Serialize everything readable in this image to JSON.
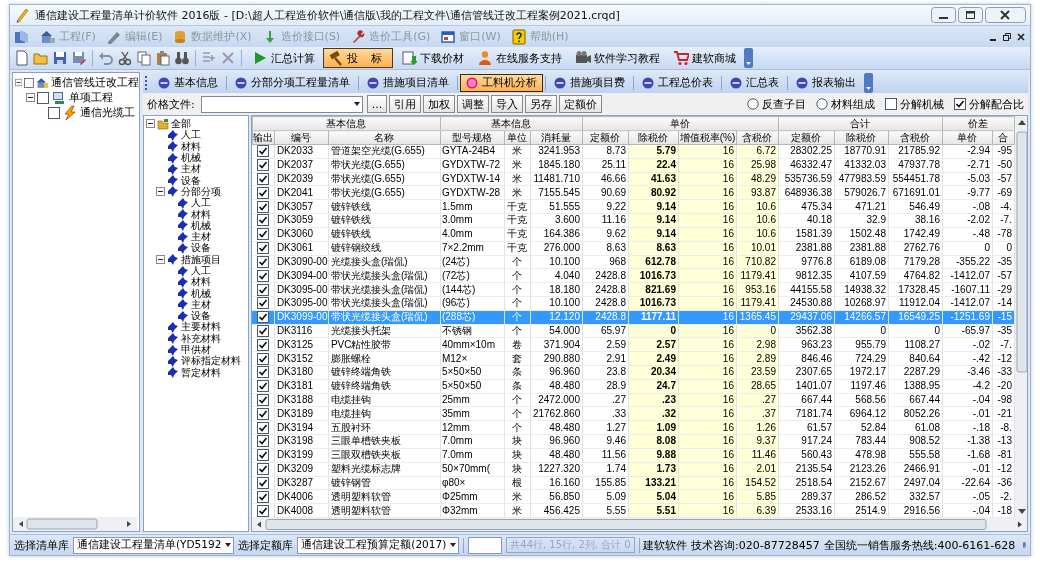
{
  "window": {
    "title": "通信建设工程量清单计价软件 2016版 - [D:\\超人工程造价软件\\通信版\\我的工程文件\\通信管线迁改工程案例2021.crqd]"
  },
  "menu": [
    {
      "label": "工程(F)",
      "disabled": true
    },
    {
      "label": "编辑(E)",
      "disabled": true
    },
    {
      "label": "数据维护(X)",
      "disabled": true
    },
    {
      "label": "造价接口(S)",
      "disabled": true
    },
    {
      "label": "造价工具(G)",
      "disabled": true
    },
    {
      "label": "窗口(W)",
      "disabled": true
    },
    {
      "label": "帮助(H)",
      "disabled": true
    }
  ],
  "toolbar": [
    {
      "label": "汇总计算",
      "selected": false
    },
    {
      "label": "投 标",
      "selected": true
    },
    {
      "label": "下载价材",
      "selected": false
    },
    {
      "label": "在线服务支持",
      "selected": false
    },
    {
      "label": "软件学习教程",
      "selected": false
    },
    {
      "label": "建软商城",
      "selected": false
    }
  ],
  "project_tree": [
    {
      "label": "通信管线迁改工程",
      "checked": false,
      "expanded": true,
      "children": [
        {
          "label": "单项工程",
          "checked": false,
          "expanded": true,
          "children": [
            {
              "label": "通信光缆工",
              "checked": false
            }
          ]
        }
      ]
    }
  ],
  "tabs": [
    {
      "label": "基本信息",
      "selected": false
    },
    {
      "label": "分部分项工程量清单",
      "selected": false
    },
    {
      "label": "措施项目清单",
      "selected": false
    },
    {
      "label": "工料机分析",
      "selected": true
    },
    {
      "label": "措施项目费",
      "selected": false
    },
    {
      "label": "工程总价表",
      "selected": false
    },
    {
      "label": "汇总表",
      "selected": false
    },
    {
      "label": "报表输出",
      "selected": false
    }
  ],
  "price_file": {
    "label": "价格文件:",
    "browse": "...",
    "buttons": [
      "引用",
      "加权",
      "调整",
      "导入",
      "另存",
      "定额价"
    ]
  },
  "options": [
    {
      "kind": "radio",
      "label": "反查子目",
      "checked": false
    },
    {
      "kind": "radio",
      "label": "材料组成",
      "checked": false
    },
    {
      "kind": "checkbox",
      "label": "分解机械",
      "checked": false
    },
    {
      "kind": "checkbox",
      "label": "分解配合比",
      "checked": true
    }
  ],
  "material_tree": [
    {
      "label": "全部",
      "expanded": true,
      "children": [
        {
          "label": "人工"
        },
        {
          "label": "材料"
        },
        {
          "label": "机械"
        },
        {
          "label": "主材"
        },
        {
          "label": "设备"
        },
        {
          "label": "分部分项",
          "expanded": true,
          "children": [
            {
              "label": "人工"
            },
            {
              "label": "材料"
            },
            {
              "label": "机械"
            },
            {
              "label": "主材"
            },
            {
              "label": "设备"
            }
          ]
        },
        {
          "label": "措施项目",
          "expanded": true,
          "children": [
            {
              "label": "人工"
            },
            {
              "label": "材料"
            },
            {
              "label": "机械"
            },
            {
              "label": "主材"
            },
            {
              "label": "设备"
            }
          ]
        },
        {
          "label": "主要材料"
        },
        {
          "label": "补充材料"
        },
        {
          "label": "甲供材"
        },
        {
          "label": "评标指定材料"
        },
        {
          "label": "暂定材料"
        }
      ]
    }
  ],
  "table": {
    "column_groups": [
      {
        "label": "基本信息",
        "columns": [
          "输出",
          "编号",
          "名称"
        ]
      },
      {
        "label": "基本信息",
        "columns": [
          "型号规格",
          "单位",
          "消耗量"
        ]
      },
      {
        "label": "单价",
        "columns": [
          "定额价",
          "除税价",
          "增值税率(%)",
          "含税价"
        ]
      },
      {
        "label": "合计",
        "columns": [
          "定额价",
          "除税价",
          "含税价"
        ]
      },
      {
        "label": "价差",
        "columns": [
          "单价",
          "合"
        ]
      }
    ],
    "rows": [
      {
        "selected": false,
        "output": true,
        "cells": [
          "DK2033",
          "管道架空光缆(G.655)",
          "GYTA-24B4",
          "米",
          "3241.953",
          "8.73",
          "5.79",
          "16",
          "6.72",
          "28302.25",
          "18770.91",
          "21785.92",
          "-2.94",
          "-95"
        ]
      },
      {
        "selected": false,
        "output": true,
        "cells": [
          "DK2037",
          "带状光缆(G.655)",
          "GYDXTW-72",
          "米",
          "1845.180",
          "25.11",
          "22.4",
          "16",
          "25.98",
          "46332.47",
          "41332.03",
          "47937.78",
          "-2.71",
          "-50"
        ]
      },
      {
        "selected": false,
        "output": true,
        "cells": [
          "DK2039",
          "带状光缆(G.655)",
          "GYDXTW-14",
          "米",
          "11481.710",
          "46.66",
          "41.63",
          "16",
          "48.29",
          "535736.59",
          "477983.59",
          "554451.78",
          "-5.03",
          "-57"
        ]
      },
      {
        "selected": false,
        "output": true,
        "cells": [
          "DK2041",
          "带状光缆(G.655)",
          "GYDXTW-28",
          "米",
          "7155.545",
          "90.69",
          "80.92",
          "16",
          "93.87",
          "648936.38",
          "579026.7",
          "671691.01",
          "-9.77",
          "-69"
        ]
      },
      {
        "selected": false,
        "output": true,
        "cells": [
          "DK3057",
          "镀锌铁线",
          "1.5mm",
          "千克",
          "51.555",
          "9.22",
          "9.14",
          "16",
          "10.6",
          "475.34",
          "471.21",
          "546.49",
          "-.08",
          "-4."
        ]
      },
      {
        "selected": false,
        "output": true,
        "cells": [
          "DK3059",
          "镀锌铁线",
          "3.0mm",
          "千克",
          "3.600",
          "11.16",
          "9.14",
          "16",
          "10.6",
          "40.18",
          "32.9",
          "38.16",
          "-2.02",
          "-7."
        ]
      },
      {
        "selected": false,
        "output": true,
        "cells": [
          "DK3060",
          "镀锌铁线",
          "4.0mm",
          "千克",
          "164.386",
          "9.62",
          "9.14",
          "16",
          "10.6",
          "1581.39",
          "1502.48",
          "1742.49",
          "-.48",
          "-78"
        ]
      },
      {
        "selected": false,
        "output": true,
        "cells": [
          "DK3061",
          "镀锌钢绞线",
          "7×2.2mm",
          "千克",
          "276.000",
          "8.63",
          "8.63",
          "16",
          "10.01",
          "2381.88",
          "2381.88",
          "2762.76",
          "0",
          "0"
        ]
      },
      {
        "selected": false,
        "output": true,
        "cells": [
          "DK3090-00",
          "光缆接头盒(瑞侃)",
          "(24芯)",
          "个",
          "10.100",
          "968",
          "612.78",
          "16",
          "710.82",
          "9776.8",
          "6189.08",
          "7179.28",
          "-355.22",
          "-35"
        ]
      },
      {
        "selected": false,
        "output": true,
        "cells": [
          "DK3094-00",
          "带状光缆接头盒(瑞侃)",
          "(72芯)",
          "个",
          "4.040",
          "2428.8",
          "1016.73",
          "16",
          "1179.41",
          "9812.35",
          "4107.59",
          "4764.82",
          "-1412.07",
          "-57"
        ]
      },
      {
        "selected": false,
        "output": true,
        "cells": [
          "DK3095-00",
          "带状光缆接头盒(瑞侃)",
          "(144芯)",
          "个",
          "18.180",
          "2428.8",
          "821.69",
          "16",
          "953.16",
          "44155.58",
          "14938.32",
          "17328.45",
          "-1607.11",
          "-29"
        ]
      },
      {
        "selected": false,
        "output": true,
        "cells": [
          "DK3095-00",
          "带状光缆接头盒(瑞侃)",
          "(96芯)",
          "个",
          "10.100",
          "2428.8",
          "1016.73",
          "16",
          "1179.41",
          "24530.88",
          "10268.97",
          "11912.04",
          "-1412.07",
          "-14"
        ]
      },
      {
        "selected": true,
        "output": true,
        "cells": [
          "DK3099-00",
          "带状光缆接头盒(瑞侃)",
          "(288芯)",
          "个",
          "12.120",
          "2428.8",
          "1177.11",
          "16",
          "1365.45",
          "29437.06",
          "14266.57",
          "16549.25",
          "-1251.69",
          "-15"
        ]
      },
      {
        "selected": false,
        "output": true,
        "cells": [
          "DK3116",
          "光缆接头托架",
          "不锈钢",
          "个",
          "54.000",
          "65.97",
          "0",
          "16",
          "0",
          "3562.38",
          "0",
          "0",
          "-65.97",
          "-35"
        ]
      },
      {
        "selected": false,
        "output": true,
        "cells": [
          "DK3125",
          "PVC粘性胶带",
          "40mm×10m",
          "卷",
          "371.904",
          "2.59",
          "2.57",
          "16",
          "2.98",
          "963.23",
          "955.79",
          "1108.27",
          "-.02",
          "-7."
        ]
      },
      {
        "selected": false,
        "output": true,
        "cells": [
          "DK3152",
          "膨胀螺栓",
          "M12×",
          "套",
          "290.880",
          "2.91",
          "2.49",
          "16",
          "2.89",
          "846.46",
          "724.29",
          "840.64",
          "-.42",
          "-12"
        ]
      },
      {
        "selected": false,
        "output": true,
        "cells": [
          "DK3180",
          "镀锌终端角铁",
          "5×50×50",
          "条",
          "96.960",
          "23.8",
          "20.34",
          "16",
          "23.59",
          "2307.65",
          "1972.17",
          "2287.29",
          "-3.46",
          "-33"
        ]
      },
      {
        "selected": false,
        "output": true,
        "cells": [
          "DK3181",
          "镀锌终端角铁",
          "5×50×50",
          "条",
          "48.480",
          "28.9",
          "24.7",
          "16",
          "28.65",
          "1401.07",
          "1197.46",
          "1388.95",
          "-4.2",
          "-20"
        ]
      },
      {
        "selected": false,
        "output": true,
        "cells": [
          "DK3188",
          "电缆挂钩",
          "25mm",
          "个",
          "2472.000",
          ".27",
          ".23",
          "16",
          ".27",
          "667.44",
          "568.56",
          "667.44",
          "-.04",
          "-98"
        ]
      },
      {
        "selected": false,
        "output": true,
        "cells": [
          "DK3189",
          "电缆挂钩",
          "35mm",
          "个",
          "21762.860",
          ".33",
          ".32",
          "16",
          ".37",
          "7181.74",
          "6964.12",
          "8052.26",
          "-.01",
          "-21"
        ]
      },
      {
        "selected": false,
        "output": true,
        "cells": [
          "DK3194",
          "五股衬环",
          "12mm",
          "个",
          "48.480",
          "1.27",
          "1.09",
          "16",
          "1.26",
          "61.57",
          "52.84",
          "61.08",
          "-.18",
          "-8."
        ]
      },
      {
        "selected": false,
        "output": true,
        "cells": [
          "DK3198",
          "三眼单槽铁夹板",
          "7.0mm",
          "块",
          "96.960",
          "9.46",
          "8.08",
          "16",
          "9.37",
          "917.24",
          "783.44",
          "908.52",
          "-1.38",
          "-13"
        ]
      },
      {
        "selected": false,
        "output": true,
        "cells": [
          "DK3199",
          "三眼双槽铁夹板",
          "7.0mm",
          "块",
          "48.480",
          "11.56",
          "9.88",
          "16",
          "11.46",
          "560.43",
          "478.98",
          "555.58",
          "-1.68",
          "-81"
        ]
      },
      {
        "selected": false,
        "output": true,
        "cells": [
          "DK3209",
          "塑料光缆标志牌",
          "50×70mm(",
          "块",
          "1227.320",
          "1.74",
          "1.73",
          "16",
          "2.01",
          "2135.54",
          "2123.26",
          "2466.91",
          "-.01",
          "-12"
        ]
      },
      {
        "selected": false,
        "output": true,
        "cells": [
          "DK3287",
          "镀锌钢管",
          "φ80×",
          "根",
          "16.160",
          "155.85",
          "133.21",
          "16",
          "154.52",
          "2518.54",
          "2152.67",
          "2497.04",
          "-22.64",
          "-36"
        ]
      },
      {
        "selected": false,
        "output": true,
        "cells": [
          "DK4006",
          "透明塑料软管",
          "Φ25mm",
          "米",
          "56.850",
          "5.09",
          "5.04",
          "16",
          "5.85",
          "289.37",
          "286.52",
          "332.57",
          "-.05",
          "-2."
        ]
      },
      {
        "selected": false,
        "output": true,
        "cells": [
          "DK4008",
          "透明塑料软管",
          "Φ32mm",
          "米",
          "456.425",
          "5.55",
          "5.51",
          "16",
          "6.39",
          "2533.16",
          "2514.9",
          "2916.56",
          "-.04",
          "-18"
        ]
      }
    ]
  },
  "status_bar": {
    "list_library_label": "选择清单库",
    "list_library": "通信建设工程量清单(YD5192",
    "quota_library_label": "选择定额库",
    "quota_library": "通信建设工程预算定额(2017)",
    "summary": "共44行, 15行, 2列, 合计 0",
    "info": [
      "建软软件",
      "技术咨询:020-87728457",
      "全国统一销售服务热线:400-6161-628"
    ]
  }
}
